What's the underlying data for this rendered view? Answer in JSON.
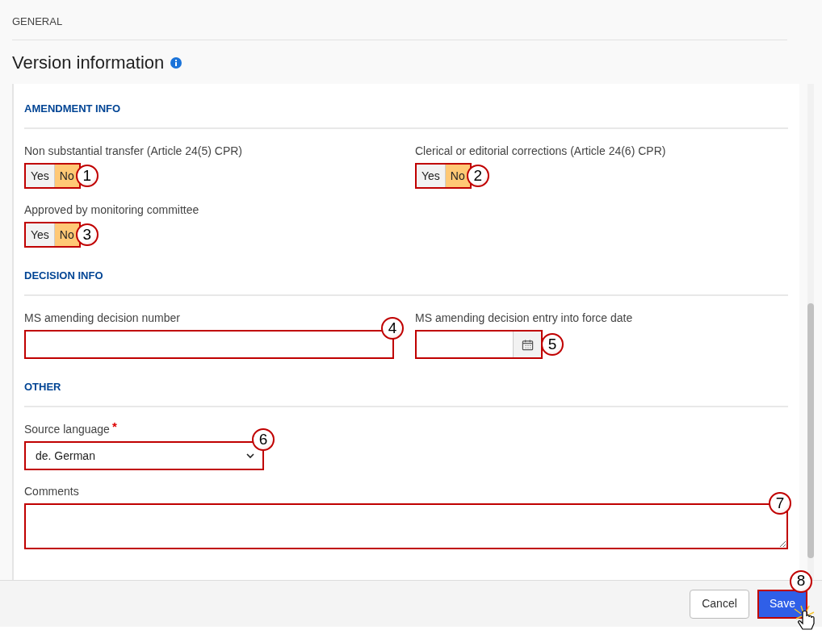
{
  "header": {
    "title": "GENERAL"
  },
  "page_title": "Version information",
  "sections": [
    {
      "title": "AMENDMENT INFO",
      "fields": [
        {
          "kind": "toggle",
          "label": "Non substantial transfer (Article 24(5) CPR)",
          "callout": "1",
          "options": [
            {
              "label": "Yes",
              "selected": false
            },
            {
              "label": "No",
              "selected": true
            }
          ]
        },
        {
          "kind": "toggle",
          "label": "Clerical or editorial corrections (Article 24(6) CPR)",
          "callout": "2",
          "options": [
            {
              "label": "Yes",
              "selected": false
            },
            {
              "label": "No",
              "selected": true
            }
          ]
        },
        {
          "kind": "toggle",
          "label": "Approved by monitoring committee",
          "callout": "3",
          "options": [
            {
              "label": "Yes",
              "selected": false
            },
            {
              "label": "No",
              "selected": true
            }
          ]
        }
      ]
    },
    {
      "title": "DECISION INFO",
      "fields": [
        {
          "kind": "text",
          "label": "MS amending decision number",
          "callout": "4"
        },
        {
          "kind": "date",
          "label": "MS amending decision entry into force date",
          "callout": "5"
        }
      ]
    },
    {
      "title": "OTHER",
      "fields": [
        {
          "kind": "select",
          "label": "Source language",
          "required_mark": "*",
          "value": "de. German",
          "callout": "6"
        },
        {
          "kind": "textarea",
          "label": "Comments",
          "callout": "7"
        }
      ]
    }
  ],
  "buttons": [
    {
      "label": "Cancel",
      "kind": "secondary"
    },
    {
      "label": "Save",
      "kind": "primary",
      "callout": "8"
    }
  ]
}
